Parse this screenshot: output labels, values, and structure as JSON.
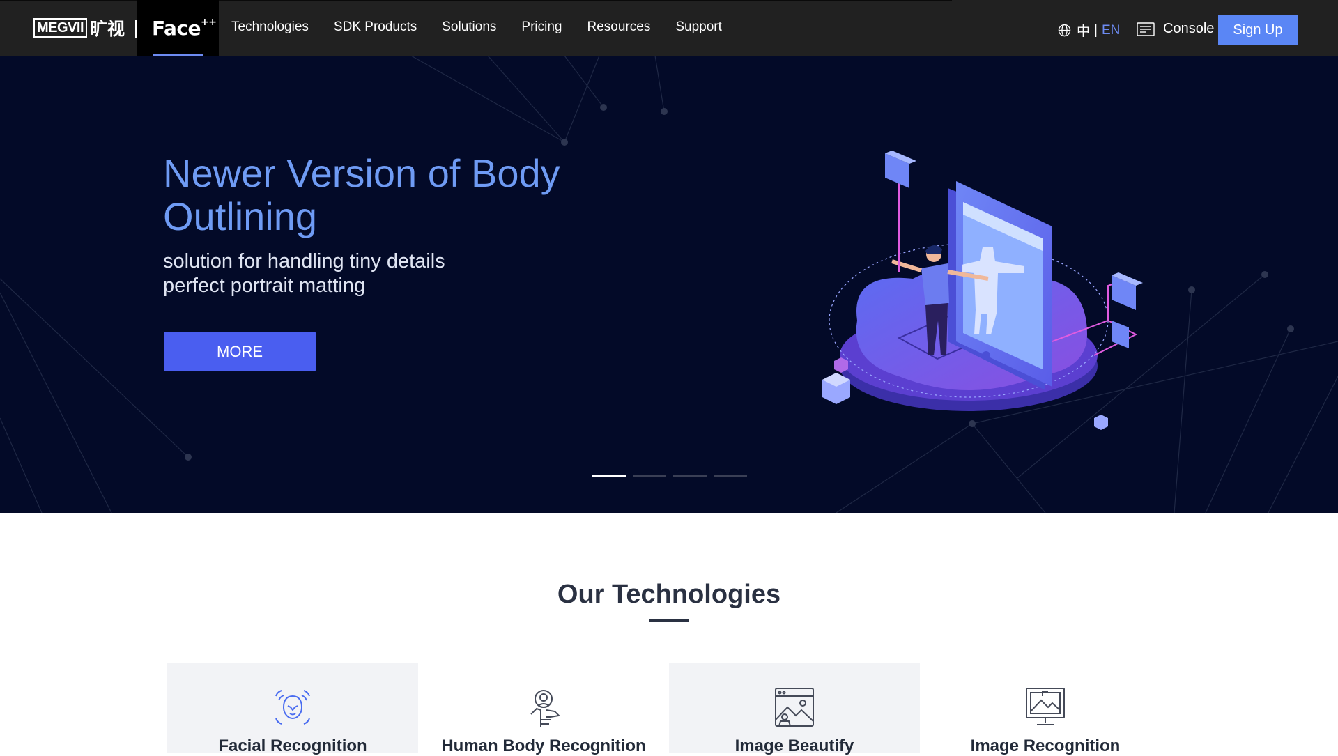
{
  "nav": {
    "logo_text": "MEGVII",
    "logo_cn": "旷视",
    "product": "Face",
    "product_sup": "++",
    "menu": [
      "Technologies",
      "SDK Products",
      "Solutions",
      "Pricing",
      "Resources",
      "Support"
    ],
    "lang_cn": "中",
    "lang_sep": "|",
    "lang_en": "EN",
    "console": "Console",
    "signup": "Sign Up"
  },
  "hero": {
    "title": "Newer Version of Body Outlining",
    "sub_line1": "solution for handling tiny details",
    "sub_line2": "perfect portrait matting",
    "button": "MORE",
    "carousel_count": 4,
    "active_slide": 1
  },
  "technologies": {
    "heading": "Our Technologies",
    "cards": [
      {
        "label": "Facial Recognition",
        "icon": "face-scan-icon"
      },
      {
        "label": "Human Body Recognition",
        "icon": "body-recognition-icon"
      },
      {
        "label": "Image Beautify",
        "icon": "image-beautify-icon"
      },
      {
        "label": "Image Recognition",
        "icon": "image-recognition-icon"
      }
    ]
  },
  "colors": {
    "nav_bg": "#212121",
    "hero_bg": "#030a28",
    "accent": "#6d8bf2",
    "button": "#4a5ef0",
    "signup": "#5a86f5"
  }
}
